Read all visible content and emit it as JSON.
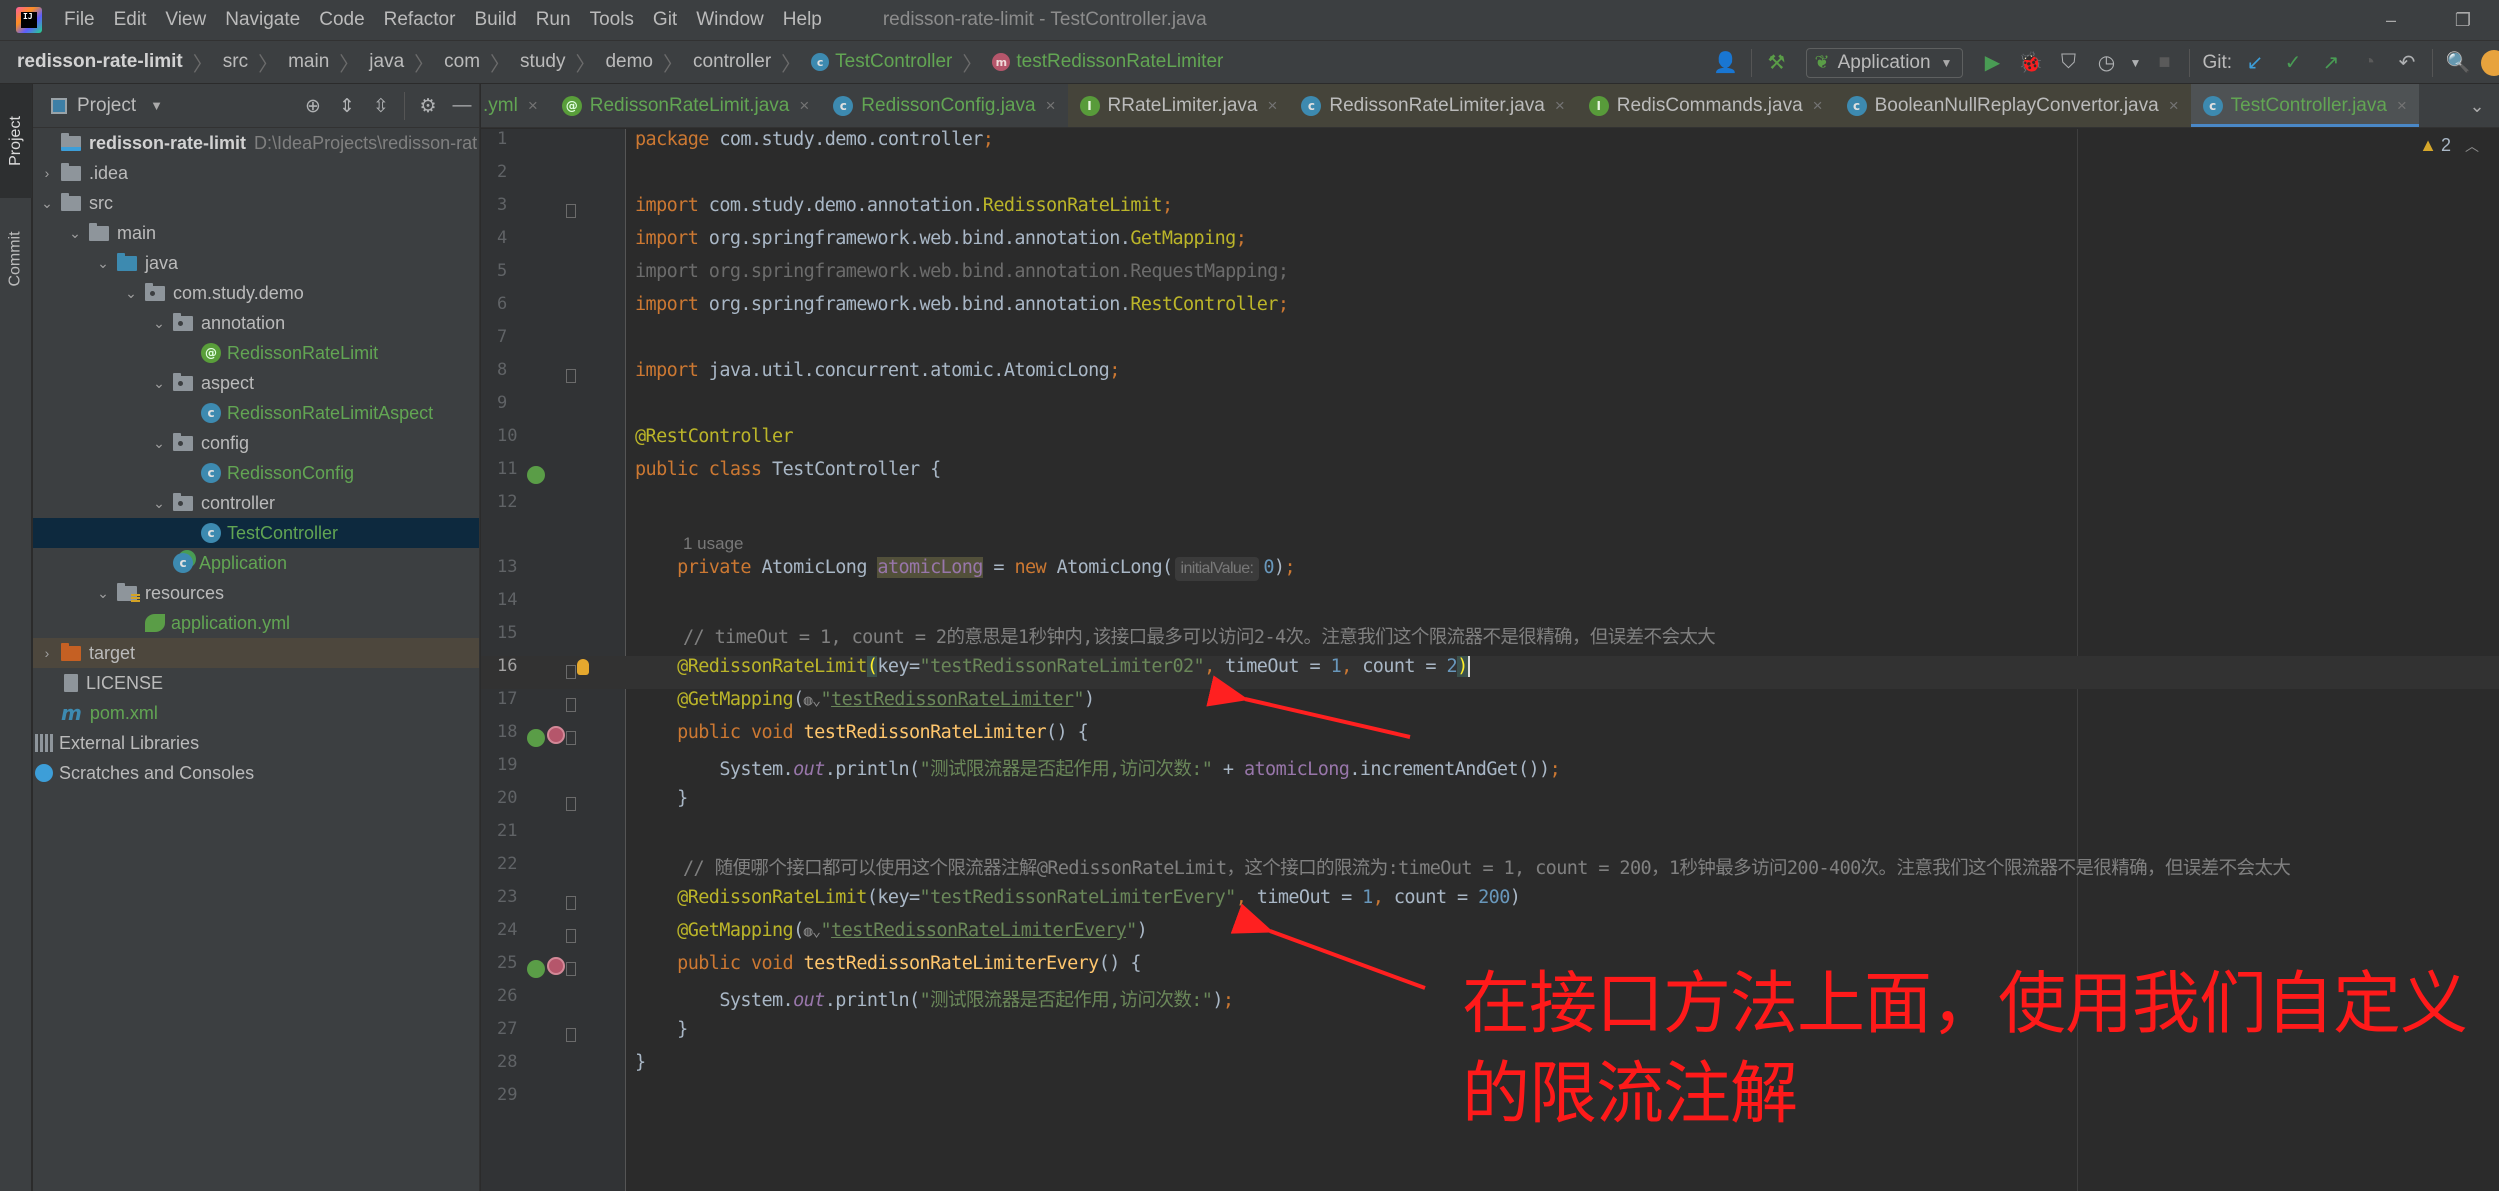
{
  "window": {
    "title": "redisson-rate-limit - TestController.java",
    "menu": [
      "File",
      "Edit",
      "View",
      "Navigate",
      "Code",
      "Refactor",
      "Build",
      "Run",
      "Tools",
      "Git",
      "Window",
      "Help"
    ],
    "controls": {
      "minimize": "–",
      "restore": "❐"
    }
  },
  "navbar": {
    "breadcrumbs": [
      "redisson-rate-limit",
      "src",
      "main",
      "java",
      "com",
      "study",
      "demo",
      "controller",
      "TestController",
      "testRedissonRateLimiter"
    ],
    "run_config": "Application",
    "git_label": "Git:"
  },
  "left_stripe": {
    "tabs": [
      "Project",
      "Commit"
    ]
  },
  "project_panel": {
    "title": "Project",
    "tree": [
      {
        "label": "redisson-rate-limit",
        "extra": "D:\\IdeaProjects\\redisson-rat",
        "depth": 0,
        "kind": "module",
        "arrow": "none"
      },
      {
        "label": ".idea",
        "depth": 0,
        "kind": "folder",
        "arrow": "collapsed"
      },
      {
        "label": "src",
        "depth": 0,
        "kind": "folder",
        "arrow": "expanded"
      },
      {
        "label": "main",
        "depth": 1,
        "kind": "folder",
        "arrow": "expanded"
      },
      {
        "label": "java",
        "depth": 2,
        "kind": "src-folder",
        "arrow": "expanded"
      },
      {
        "label": "com.study.demo",
        "depth": 3,
        "kind": "package",
        "arrow": "expanded"
      },
      {
        "label": "annotation",
        "depth": 4,
        "kind": "package",
        "arrow": "expanded"
      },
      {
        "label": "RedissonRateLimit",
        "depth": 5,
        "kind": "annotation",
        "arrow": "none"
      },
      {
        "label": "aspect",
        "depth": 4,
        "kind": "package",
        "arrow": "expanded"
      },
      {
        "label": "RedissonRateLimitAspect",
        "depth": 5,
        "kind": "class",
        "arrow": "none"
      },
      {
        "label": "config",
        "depth": 4,
        "kind": "package",
        "arrow": "expanded"
      },
      {
        "label": "RedissonConfig",
        "depth": 5,
        "kind": "class",
        "arrow": "none"
      },
      {
        "label": "controller",
        "depth": 4,
        "kind": "package",
        "arrow": "expanded"
      },
      {
        "label": "TestController",
        "depth": 5,
        "kind": "class",
        "arrow": "none",
        "selected": true
      },
      {
        "label": "Application",
        "depth": 4,
        "kind": "spring-class",
        "arrow": "none"
      },
      {
        "label": "resources",
        "depth": 2,
        "kind": "res-folder",
        "arrow": "expanded"
      },
      {
        "label": "application.yml",
        "depth": 3,
        "kind": "spring-yml",
        "arrow": "none"
      },
      {
        "label": "target",
        "depth": 0,
        "kind": "target-folder",
        "arrow": "collapsed",
        "excluded": true
      },
      {
        "label": "LICENSE",
        "depth": 0,
        "kind": "text-file",
        "arrow": "none"
      },
      {
        "label": "pom.xml",
        "depth": 0,
        "kind": "maven",
        "arrow": "none"
      },
      {
        "label": "External Libraries",
        "depth": -1,
        "kind": "libraries",
        "arrow": "none"
      },
      {
        "label": "Scratches and Consoles",
        "depth": -1,
        "kind": "scratches",
        "arrow": "none"
      }
    ]
  },
  "editor": {
    "tabs": [
      {
        "label": ".yml",
        "icon": "none",
        "green": true,
        "ext": false
      },
      {
        "label": "RedissonRateLimit.java",
        "icon": "@",
        "green": true,
        "ext": false
      },
      {
        "label": "RedissonConfig.java",
        "icon": "c",
        "green": true,
        "ext": false
      },
      {
        "label": "RRateLimiter.java",
        "icon": "I",
        "green": false,
        "ext": true
      },
      {
        "label": "RedissonRateLimiter.java",
        "icon": "c",
        "green": false,
        "ext": true
      },
      {
        "label": "RedisCommands.java",
        "icon": "I",
        "green": false,
        "ext": true
      },
      {
        "label": "BooleanNullReplayConvertor.java",
        "icon": "c",
        "green": false,
        "ext": true
      },
      {
        "label": "TestController.java",
        "icon": "c",
        "green": true,
        "ext": false,
        "active": true
      }
    ],
    "warnings_count": "2",
    "usage_hint": "1 usage",
    "param_hint": "initialValue:",
    "lines": {
      "l1": {
        "n": "1"
      },
      "l2": {
        "n": "2"
      },
      "l3": {
        "n": "3"
      },
      "l4": {
        "n": "4"
      },
      "l5": {
        "n": "5"
      },
      "l6": {
        "n": "6"
      },
      "l7": {
        "n": "7"
      },
      "l8": {
        "n": "8"
      },
      "l9": {
        "n": "9"
      },
      "l10": {
        "n": "10"
      },
      "l11": {
        "n": "11"
      },
      "l12": {
        "n": "12"
      },
      "l13": {
        "n": "13"
      },
      "l14": {
        "n": "14"
      },
      "l15": {
        "n": "15"
      },
      "l16": {
        "n": "16"
      },
      "l17": {
        "n": "17"
      },
      "l18": {
        "n": "18"
      },
      "l19": {
        "n": "19"
      },
      "l20": {
        "n": "20"
      },
      "l21": {
        "n": "21"
      },
      "l22": {
        "n": "22"
      },
      "l23": {
        "n": "23"
      },
      "l24": {
        "n": "24"
      },
      "l25": {
        "n": "25"
      },
      "l26": {
        "n": "26"
      },
      "l27": {
        "n": "27"
      },
      "l28": {
        "n": "28"
      },
      "l29": {
        "n": "29"
      }
    },
    "code": {
      "package_kw": "package",
      "package_name": "com.study.demo.controller",
      "import_kw": "import",
      "imp3_pkg": "com.study.demo.annotation.",
      "imp3_cls": "RedissonRateLimit",
      "imp4_pkg": "org.springframework.web.bind.annotation.",
      "imp4_cls": "GetMapping",
      "imp5": "import org.springframework.web.bind.annotation.RequestMapping;",
      "imp6_pkg": "org.springframework.web.bind.annotation.",
      "imp6_cls": "RestController",
      "imp8": "java.util.concurrent.atomic.AtomicLong",
      "rest_ann": "@RestController",
      "public_kw": "public",
      "class_kw": "class",
      "class_name": "TestController",
      "private_kw": "private",
      "void_kw": "void",
      "new_kw": "new",
      "atomic_type": "AtomicLong",
      "atomic_field": "atomicLong",
      "atomic_ctor": "AtomicLong(",
      "zero": "0",
      "cmt15": "// timeOut = 1, count = 2的意思是1秒钟内,该接口最多可以访问2-4次。注意我们这个限流器不是很精确，但误差不会太大",
      "rrl_ann": "@RedissonRateLimit",
      "key_attr": "key=",
      "key1": "\"testRedissonRateLimiter02\"",
      "timeout_attr": "timeOut = ",
      "one": "1",
      "count_attr": "count = ",
      "two": "2",
      "getmapping_ann": "@GetMapping",
      "url1": "testRedissonRateLimiter",
      "method1": "testRedissonRateLimiter",
      "sys": "System.",
      "out": "out",
      "println": ".println(",
      "str1": "\"测试限流器是否起作用,访问次数:\"",
      "plus": " + ",
      "incr": ".incrementAndGet()",
      "cmt22": "// 随便哪个接口都可以使用这个限流器注解@RedissonRateLimit，这个接口的限流为:timeOut = 1, count = 200，1秒钟最多访问200-400次。注意我们这个限流器不是很精确，但误差不会太大",
      "key2": "\"testRedissonRateLimiterEvery\"",
      "count200": "200",
      "url2": "testRedissonRateLimiterEvery",
      "method2": "testRedissonRateLimiterEvery"
    }
  },
  "annotation_note": {
    "text": "在接口方法上面，使用我们自定义的限流注解",
    "color": "#ff1a1a"
  },
  "colors": {
    "keyword": "#cc7832",
    "annotation": "#bbb529",
    "string": "#6a8759",
    "number": "#6897bb",
    "comment": "#808080",
    "field": "#9876aa",
    "method": "#ffc66d",
    "project_green": "#62a553",
    "accent_blue": "#4a88c7"
  }
}
